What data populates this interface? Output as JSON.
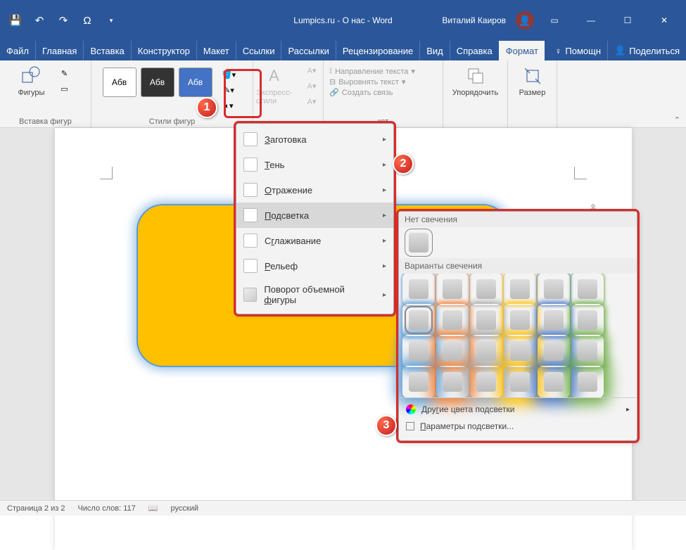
{
  "title": "Lumpics.ru - О нас  -  Word",
  "user": "Виталий Каиров",
  "menu": {
    "items": [
      "Файл",
      "Главная",
      "Вставка",
      "Конструктор",
      "Макет",
      "Ссылки",
      "Рассылки",
      "Рецензирование",
      "Вид",
      "Справка",
      "Формат"
    ],
    "active_index": 10,
    "help": "Помощн",
    "share": "Поделиться"
  },
  "ribbon": {
    "shapes_label": "Фигуры",
    "insert_shapes": "Вставка фигур",
    "styles_label": "Стили фигур",
    "abv": "Абв",
    "express": "Экспресс-стили",
    "text_direction": "Направление текста",
    "align_text": "Выровнять текст",
    "create_link": "Создать связь",
    "text_group_suffix": "кст",
    "arrange": "Упорядочить",
    "size": "Размер"
  },
  "dropdown": {
    "items": [
      {
        "label_pre": "",
        "u": "З",
        "label_post": "аготовка"
      },
      {
        "label_pre": "",
        "u": "Т",
        "label_post": "ень"
      },
      {
        "label_pre": "",
        "u": "О",
        "label_post": "тражение"
      },
      {
        "label_pre": "",
        "u": "П",
        "label_post": "одсветка",
        "hover": true
      },
      {
        "label_pre": "С",
        "u": "г",
        "label_post": "лаживание"
      },
      {
        "label_pre": "",
        "u": "Р",
        "label_post": "ельеф"
      },
      {
        "label_pre": "Поворот объемной ",
        "u": "ф",
        "label_post": "игуры",
        "cube": true
      }
    ]
  },
  "glow": {
    "no_glow": "Нет свечения",
    "variants": "Варианты свечения",
    "colors": [
      "g-blue",
      "g-orange",
      "g-gray",
      "g-yellow",
      "g-dblue",
      "g-green"
    ],
    "more_colors_pre": "Дру",
    "more_colors_u": "г",
    "more_colors_post": "ие цвета подсветки",
    "params_pre": "",
    "params_u": "П",
    "params_post": "араметры подсветки..."
  },
  "status": {
    "page": "Страница 2 из 2",
    "words": "Число слов: 117",
    "lang": "русский"
  },
  "badges": {
    "b1": "1",
    "b2": "2",
    "b3": "3"
  }
}
